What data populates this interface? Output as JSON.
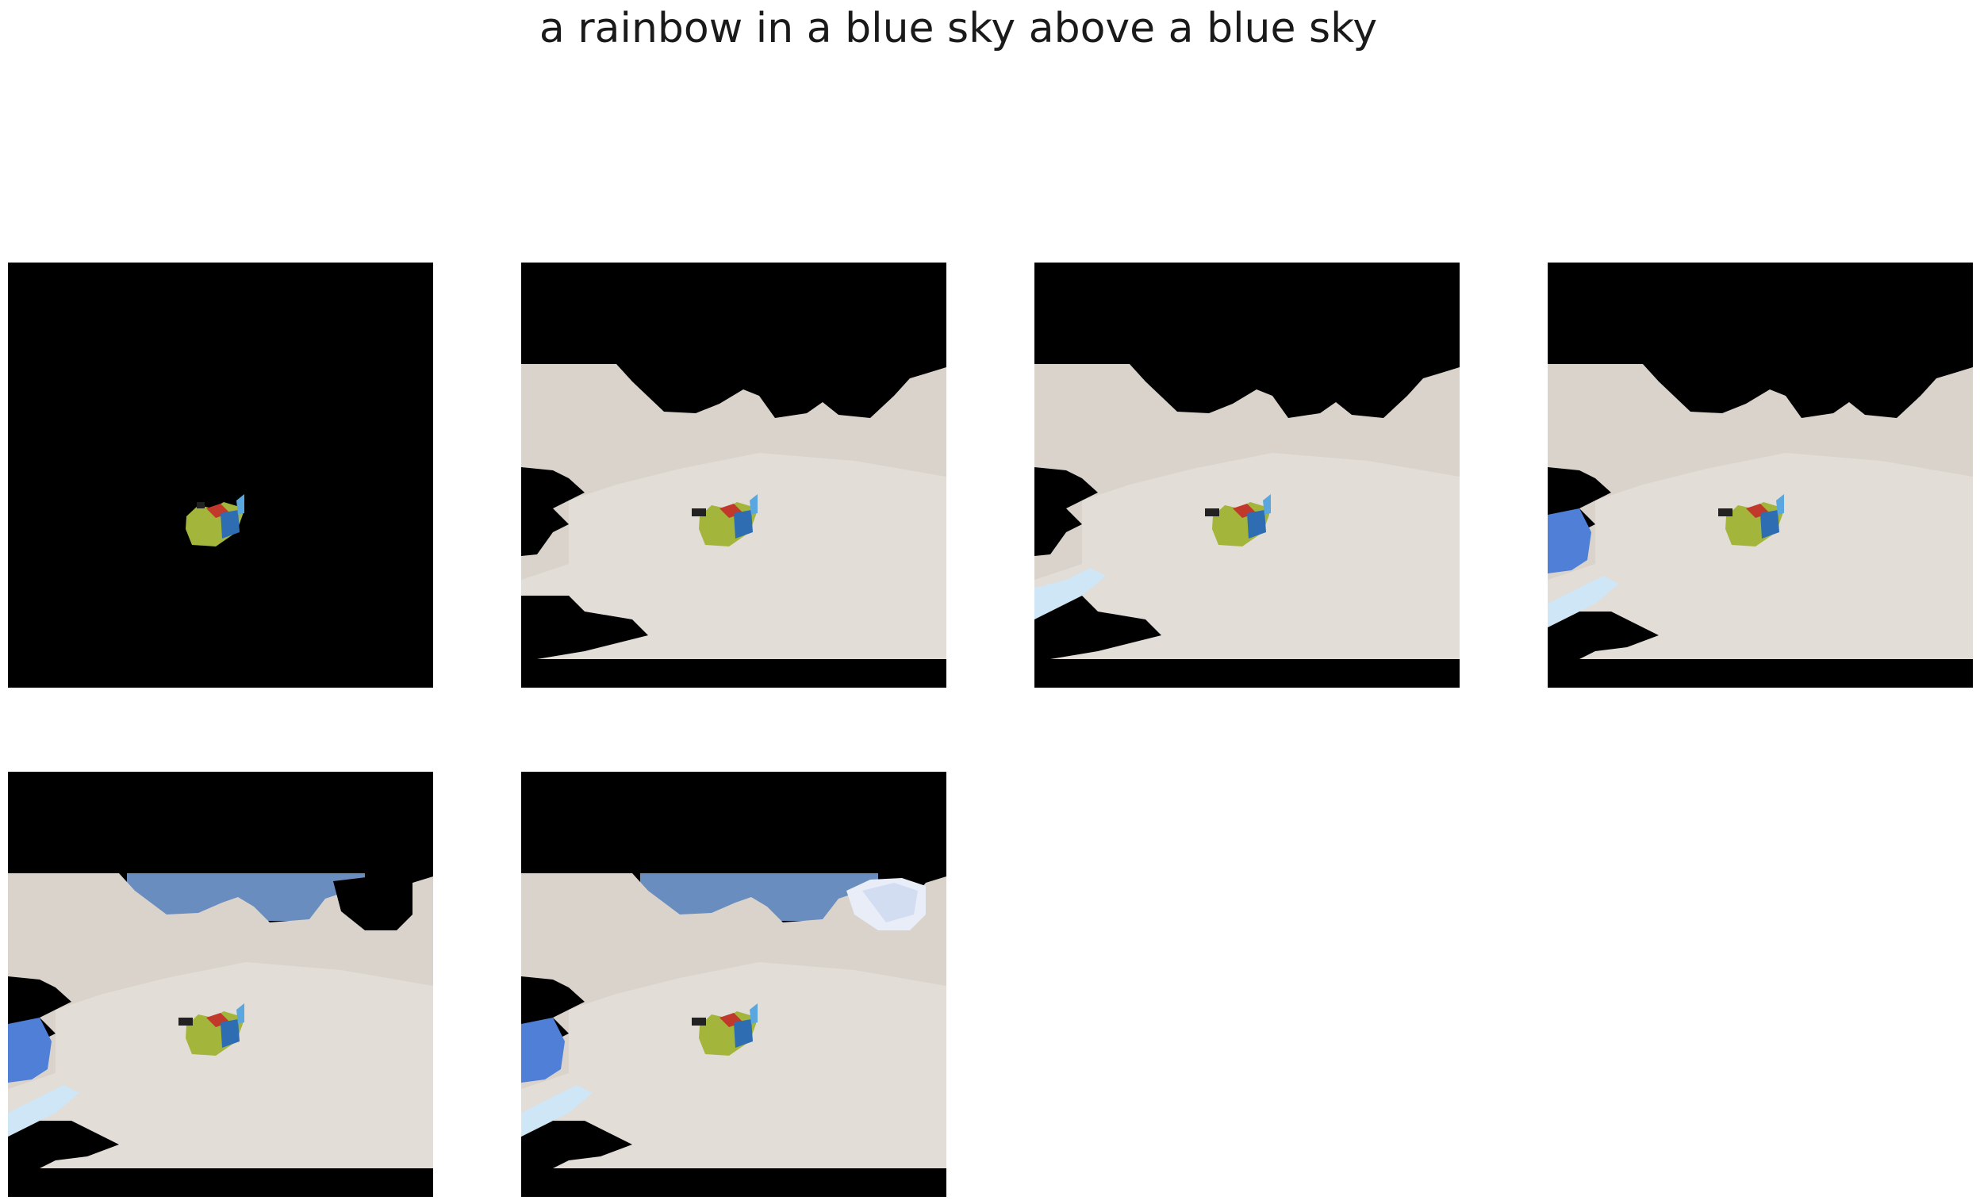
{
  "figure": {
    "title": "a rainbow in a blue sky above a blue sky"
  },
  "colors": {
    "background": "#ffffff",
    "mask": "#000000",
    "cloud": "#d9d3cb",
    "cloud_light": "#e6e1da",
    "sky": "#6a8dbf",
    "deep_blue": "#4f7fd6",
    "streak": "#cfe6f7"
  },
  "panels": [
    {
      "step": 1,
      "content": [
        "bird"
      ]
    },
    {
      "step": 2,
      "content": [
        "bird",
        "clouds"
      ]
    },
    {
      "step": 3,
      "content": [
        "bird",
        "clouds",
        "streak"
      ]
    },
    {
      "step": 4,
      "content": [
        "bird",
        "clouds",
        "streak",
        "blue-patch"
      ]
    },
    {
      "step": 5,
      "content": [
        "bird",
        "clouds",
        "streak",
        "blue-patch",
        "sky"
      ]
    },
    {
      "step": 6,
      "content": [
        "bird",
        "clouds",
        "streak",
        "blue-patch",
        "sky",
        "bright-cloud"
      ]
    }
  ]
}
